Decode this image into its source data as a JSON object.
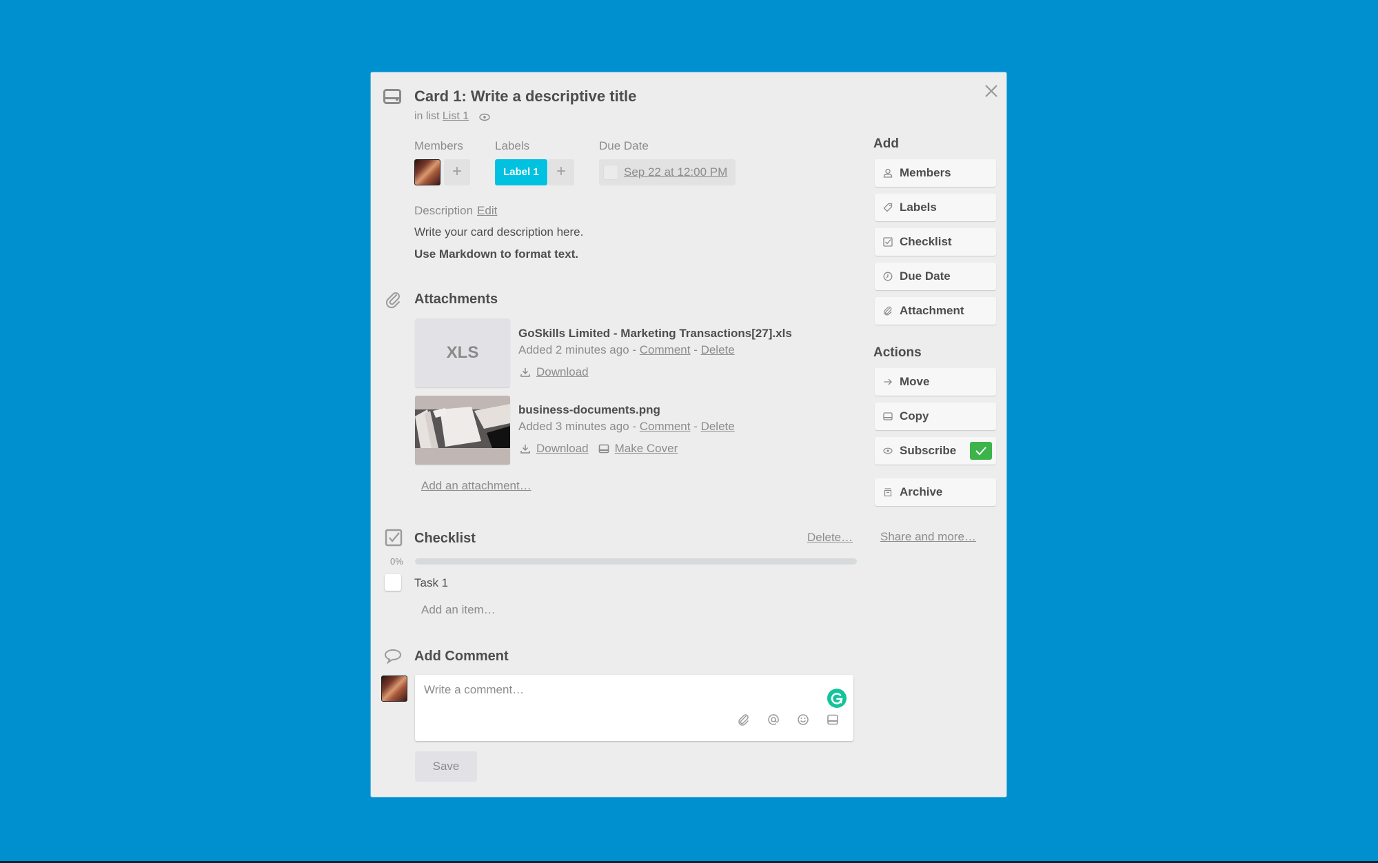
{
  "card": {
    "title": "Card 1: Write a descriptive title",
    "in_list_prefix": "in list",
    "list_name": "List 1",
    "close_icon": "close-icon",
    "card_icon": "card-icon"
  },
  "fields": {
    "members_label": "Members",
    "add_member": "+",
    "labels_label": "Labels",
    "label_chip": "Label 1",
    "label_color": "#00c2e0",
    "add_label": "+",
    "due_date_label": "Due Date",
    "due_date_value": "Sep 22 at 12:00 PM",
    "due_complete": false
  },
  "description": {
    "label": "Description",
    "edit_link": "Edit",
    "line1": "Write your card description here.",
    "line2": "Use Markdown to format text."
  },
  "attachments": {
    "title": "Attachments",
    "items": [
      {
        "thumb_text": "XLS",
        "name": "GoSkills Limited - Marketing Transactions[27].xls",
        "added": "Added 2 minutes ago - ",
        "comment": "Comment",
        "sep": " - ",
        "delete": "Delete",
        "download": "Download"
      },
      {
        "thumb_text": "",
        "name": "business-documents.png",
        "added": "Added 3 minutes ago - ",
        "comment": "Comment",
        "sep": " - ",
        "delete": "Delete",
        "download": "Download",
        "make_cover": "Make Cover"
      }
    ],
    "add_link": "Add an attachment…"
  },
  "checklist": {
    "title": "Checklist",
    "delete_link": "Delete…",
    "progress_label": "0%",
    "progress": 0,
    "items": [
      {
        "text": "Task 1",
        "checked": false
      }
    ],
    "add_item": "Add an item…"
  },
  "comment": {
    "title": "Add Comment",
    "placeholder": "Write a comment…",
    "save": "Save",
    "tools": [
      "attachment-icon",
      "mention-icon",
      "emoji-icon",
      "card-icon"
    ],
    "grammarly_color": "#15c39a"
  },
  "sidebar": {
    "add_heading": "Add",
    "add_buttons": [
      {
        "label": "Members",
        "icon": "person-icon"
      },
      {
        "label": "Labels",
        "icon": "tag-icon"
      },
      {
        "label": "Checklist",
        "icon": "checklist-icon"
      },
      {
        "label": "Due Date",
        "icon": "clock-icon"
      },
      {
        "label": "Attachment",
        "icon": "paperclip-icon"
      }
    ],
    "actions_heading": "Actions",
    "action_buttons": [
      {
        "label": "Move",
        "icon": "arrow-right-icon"
      },
      {
        "label": "Copy",
        "icon": "card-icon"
      },
      {
        "label": "Subscribe",
        "icon": "eye-icon",
        "checked": true
      },
      {
        "label": "Archive",
        "icon": "archive-icon"
      }
    ],
    "share_link": "Share and more…",
    "subscribe_check_color": "#3cb44a"
  },
  "colors": {
    "background": "#0090cf",
    "modal": "#ededed"
  }
}
